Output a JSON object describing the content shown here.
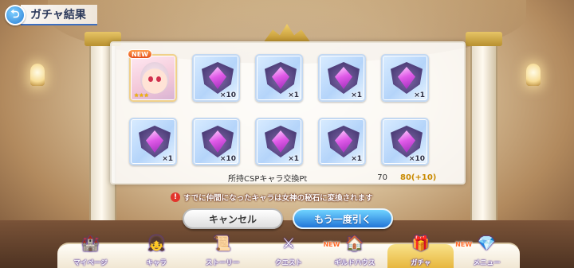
{
  "header": {
    "title": "ガチャ結果",
    "back_icon": "back-arrow-icon"
  },
  "results": {
    "items": [
      {
        "kind": "character",
        "qty": "",
        "badge": "NEW",
        "stars": "★★★"
      },
      {
        "kind": "memory-piece",
        "qty": "×10"
      },
      {
        "kind": "memory-piece",
        "qty": "×1"
      },
      {
        "kind": "memory-piece",
        "qty": "×1"
      },
      {
        "kind": "memory-piece",
        "qty": "×1"
      },
      {
        "kind": "memory-piece",
        "qty": "×1"
      },
      {
        "kind": "memory-piece",
        "qty": "×10"
      },
      {
        "kind": "memory-piece",
        "qty": "×1"
      },
      {
        "kind": "memory-piece",
        "qty": "×1"
      },
      {
        "kind": "memory-piece",
        "qty": "×10"
      }
    ],
    "points": {
      "label": "所持CSPキャラ交換Pt",
      "before": "70",
      "after": "80(+10)"
    }
  },
  "notice": "すでに仲間になったキャラは女神の秘石に変換されます",
  "buttons": {
    "cancel": "キャンセル",
    "again": "もう一度引く"
  },
  "nav": {
    "items": [
      {
        "label": "マイページ",
        "icon": "mypage-icon"
      },
      {
        "label": "キャラ",
        "icon": "character-icon"
      },
      {
        "label": "ストーリー",
        "icon": "story-icon"
      },
      {
        "label": "クエスト",
        "icon": "quest-icon"
      },
      {
        "label": "ギルドハウス",
        "icon": "guildhouse-icon",
        "badge": "NEW"
      },
      {
        "label": "ガチャ",
        "icon": "gacha-icon",
        "active": true
      },
      {
        "label": "メニュー",
        "icon": "menu-icon",
        "badge": "NEW"
      }
    ]
  },
  "colors": {
    "accent": "#2276d8",
    "points_gain": "#c98a00",
    "warning": "#e2342b"
  }
}
